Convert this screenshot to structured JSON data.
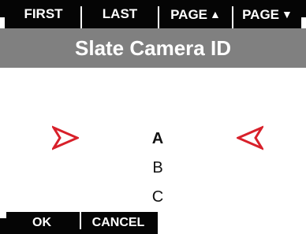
{
  "toolbar": {
    "first_label": "FIRST",
    "last_label": "LAST",
    "page_up_label": "PAGE",
    "page_down_label": "PAGE",
    "page_up_glyph": "▲",
    "page_down_glyph": "▼"
  },
  "title": "Slate Camera ID",
  "list": {
    "items": [
      "A",
      "B",
      "C"
    ],
    "selected_index": 0
  },
  "footer": {
    "ok_label": "OK",
    "cancel_label": "CANCEL"
  },
  "icons": {
    "left_marker": "right-pointing-arrowhead-icon",
    "right_marker": "left-pointing-arrowhead-icon"
  },
  "colors": {
    "bar_bg": "#050505",
    "title_bg": "#808080",
    "marker": "#d8202a",
    "text": "#111111"
  }
}
